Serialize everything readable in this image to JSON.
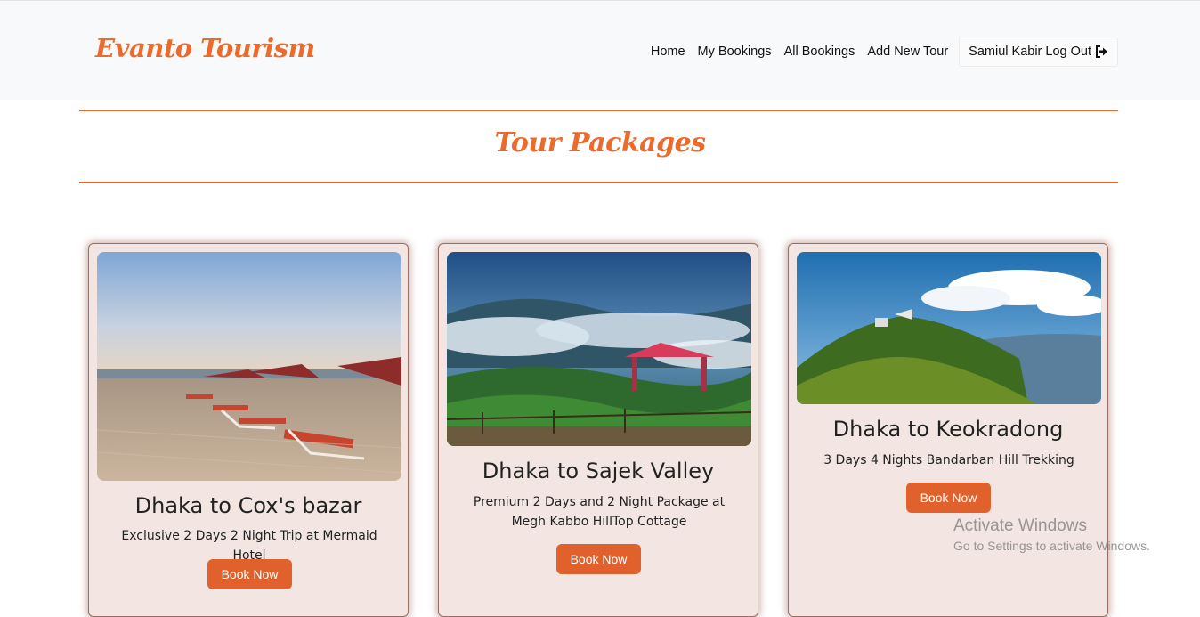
{
  "brand": {
    "name": "Evanto Tourism"
  },
  "nav": {
    "items": [
      {
        "label": "Home"
      },
      {
        "label": "My Bookings"
      },
      {
        "label": "All Bookings"
      },
      {
        "label": "Add New Tour"
      }
    ],
    "user_label": "Samiul Kabir Log Out",
    "logout_icon": "sign-out-icon"
  },
  "section": {
    "title": "Tour Packages"
  },
  "tours": [
    {
      "title": "Dhaka to Cox's bazar",
      "description": "Exclusive 2 Days 2 Night Trip at Mermaid Hotel",
      "button": "Book Now",
      "image": "beach-with-lounge-chairs-image"
    },
    {
      "title": "Dhaka to Sajek Valley",
      "description": "Premium 2 Days and 2 Night Package at Megh Kabbo HillTop Cottage",
      "button": "Book Now",
      "image": "cloudy-hills-with-red-gazebo-image"
    },
    {
      "title": "Dhaka to Keokradong",
      "description": "3 Days 4 Nights Bandarban Hill Trekking",
      "button": "Book Now",
      "image": "green-hilltop-with-sky-image"
    }
  ],
  "watermark": {
    "line1": "Activate Windows",
    "line2": "Go to Settings to activate Windows."
  },
  "colors": {
    "accent": "#ec6a2c",
    "button": "#e0612b",
    "card_bg": "#f3e6e2"
  }
}
